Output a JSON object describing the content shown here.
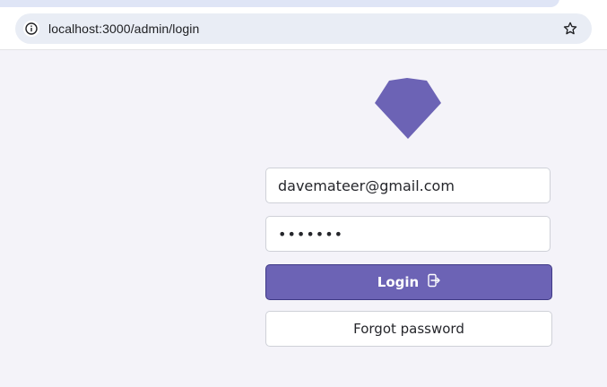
{
  "browser": {
    "url": "localhost:3000/admin/login",
    "info_icon": "info-icon",
    "bookmark_icon": "star-icon"
  },
  "login_form": {
    "logo_icon": "gem-icon",
    "email_value": "davemateer@gmail.com",
    "password_value": "•••••••",
    "login_label": "Login",
    "login_icon": "sign-in-icon",
    "forgot_label": "Forgot password"
  },
  "colors": {
    "accent": "#6c63b5",
    "page_background": "#f4f3f9"
  }
}
